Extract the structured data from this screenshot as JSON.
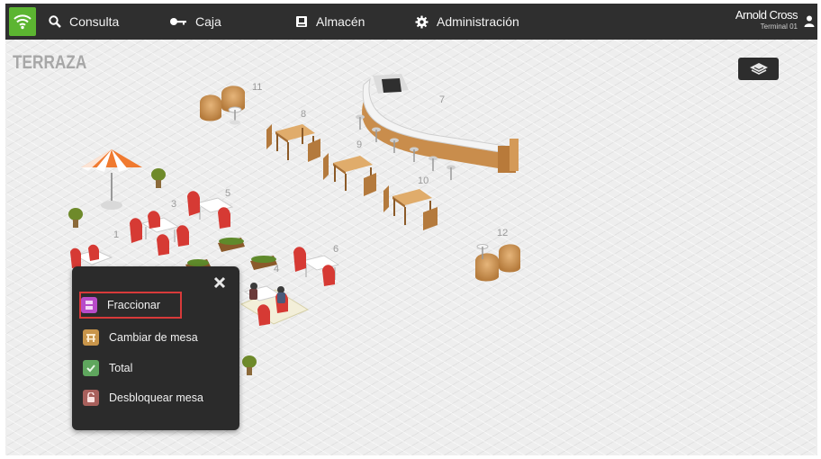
{
  "topbar": {
    "nav": [
      {
        "label": "Consulta",
        "icon": "search-icon"
      },
      {
        "label": "Caja",
        "icon": "key-icon"
      },
      {
        "label": "Almacén",
        "icon": "warehouse-icon"
      },
      {
        "label": "Administración",
        "icon": "gear-icon"
      }
    ],
    "user": {
      "name": "Arnold Cross",
      "terminal": "Terminal 01"
    },
    "accent": "#5cb531",
    "background": "#2f2f2f"
  },
  "floor": {
    "area_name": "TERRAZA",
    "table_numbers": [
      "1",
      "3",
      "4",
      "5",
      "6",
      "7",
      "8",
      "9",
      "10",
      "11",
      "12"
    ]
  },
  "popup": {
    "items": [
      {
        "label": "Fraccionar",
        "icon": "split-icon",
        "color": "#b84bc9",
        "selected": true
      },
      {
        "label": "Cambiar de mesa",
        "icon": "move-table-icon",
        "color": "#c8954a",
        "selected": false
      },
      {
        "label": "Total",
        "icon": "total-icon",
        "color": "#5fa65e",
        "selected": false
      },
      {
        "label": "Desbloquear mesa",
        "icon": "unlock-icon",
        "color": "#a8605c",
        "selected": false
      }
    ],
    "selection_color": "#d83a3a"
  }
}
